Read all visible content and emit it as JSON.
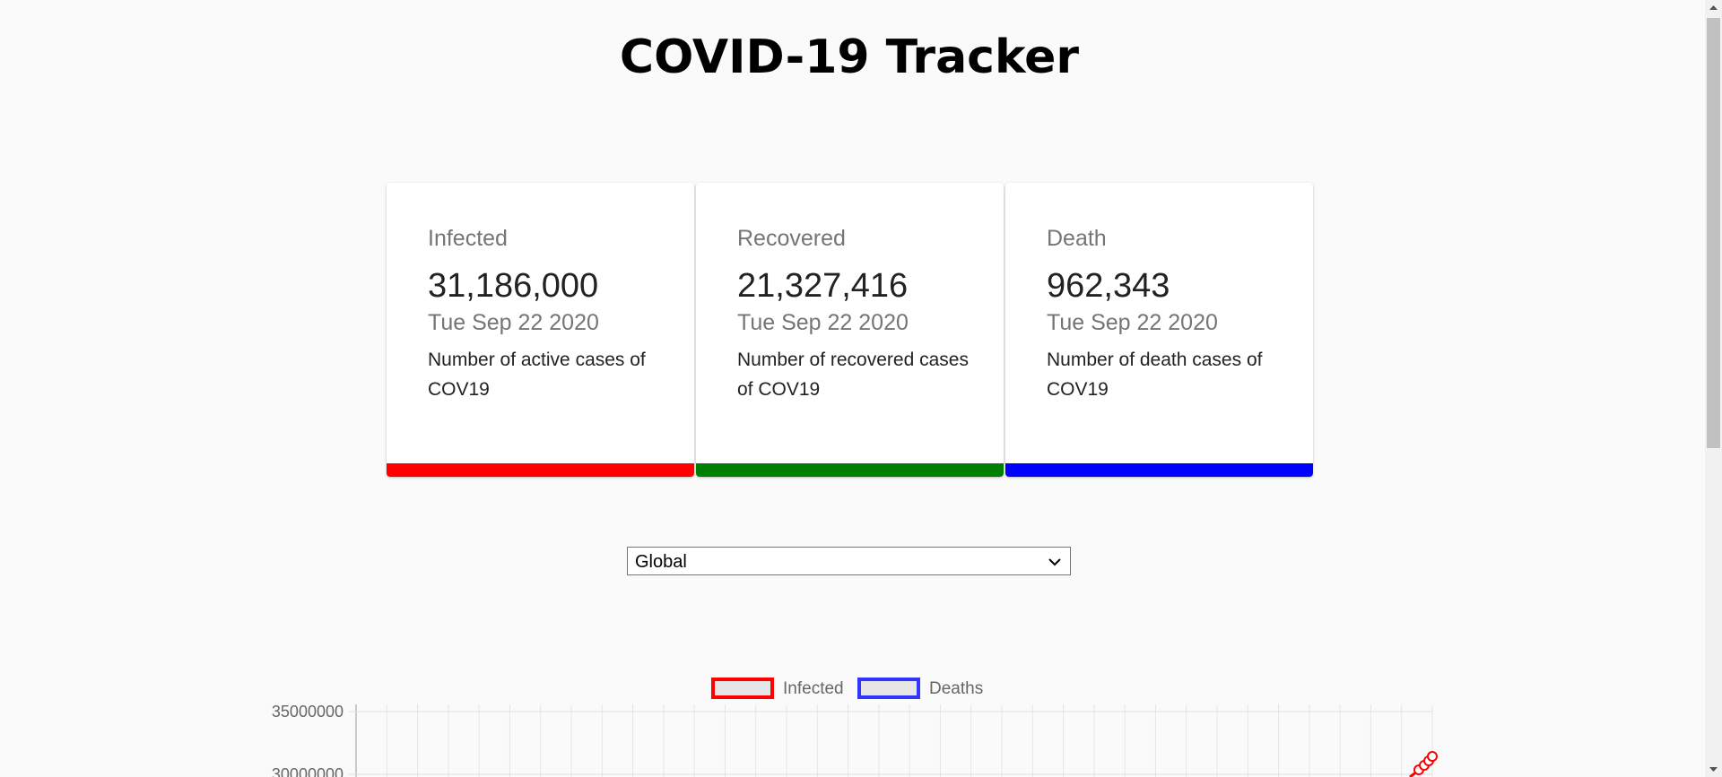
{
  "header": {
    "title": "COVID-19 Tracker"
  },
  "cards": [
    {
      "label": "Infected",
      "value": "31,186,000",
      "date": "Tue Sep 22 2020",
      "description": "Number of active cases of COV19",
      "accent_color": "#ff0000"
    },
    {
      "label": "Recovered",
      "value": "21,327,416",
      "date": "Tue Sep 22 2020",
      "description": "Number of recovered cases of COV19",
      "accent_color": "#008000"
    },
    {
      "label": "Death",
      "value": "962,343",
      "date": "Tue Sep 22 2020",
      "description": "Number of death cases of COV19",
      "accent_color": "#0000ff"
    }
  ],
  "country_picker": {
    "selected": "Global"
  },
  "chart": {
    "legend": [
      {
        "name": "Infected",
        "border_color": "#ff0000"
      },
      {
        "name": "Deaths",
        "border_color": "#3333ff"
      }
    ],
    "y_ticks": [
      "35000000",
      "30000000"
    ],
    "chart_data": {
      "type": "line",
      "series": [
        {
          "name": "Infected",
          "color": "#ff0000"
        },
        {
          "name": "Deaths",
          "color": "#3333ff"
        }
      ],
      "ylim_visible": [
        30000000,
        35000000
      ],
      "grid": true,
      "legend_position": "top"
    }
  }
}
